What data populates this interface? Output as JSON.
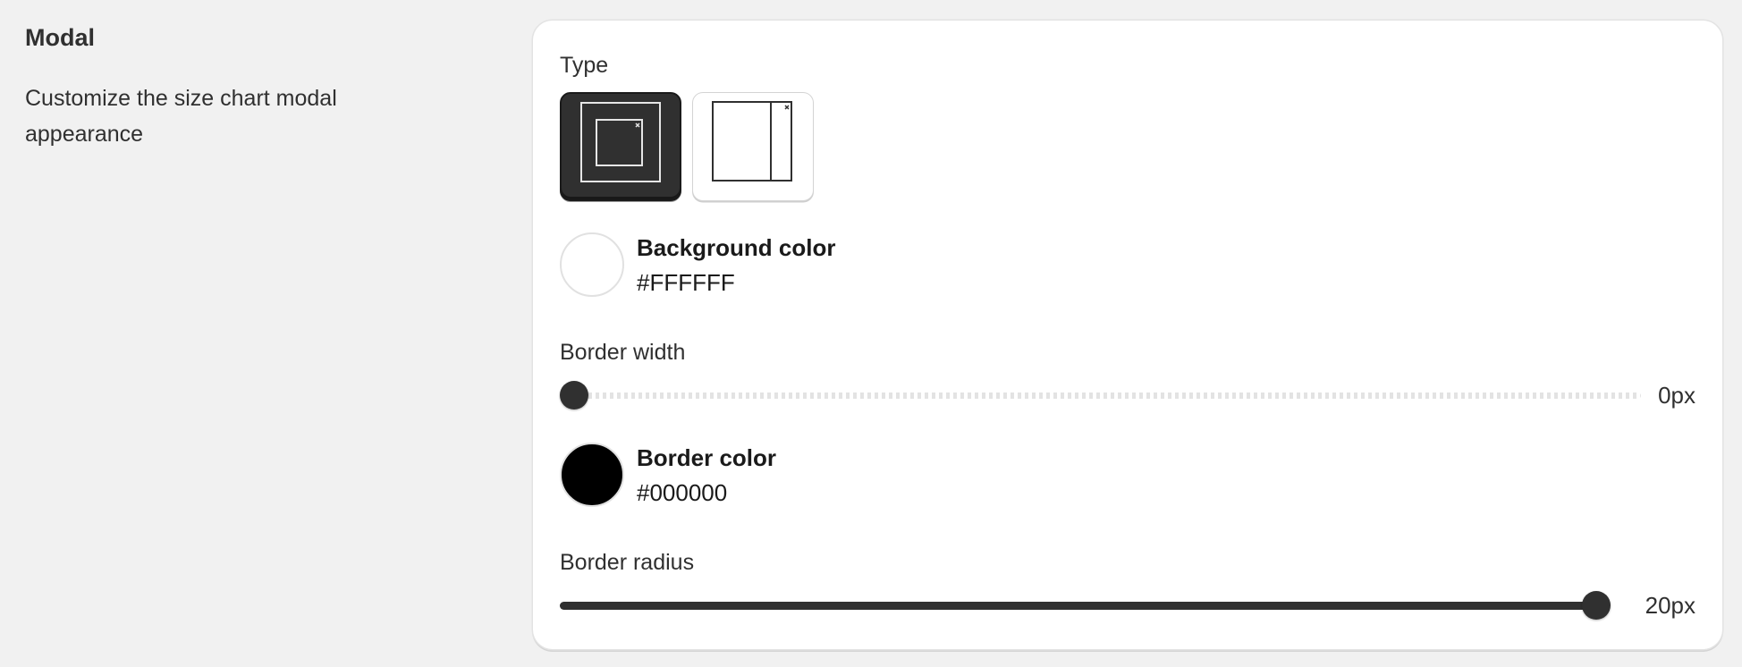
{
  "section": {
    "title": "Modal",
    "description": "Customize the size chart modal appearance"
  },
  "type_field": {
    "label": "Type",
    "options": [
      {
        "name": "centered-modal",
        "icon": "modal-centered-icon",
        "selected": true
      },
      {
        "name": "side-drawer",
        "icon": "drawer-right-icon",
        "selected": false
      }
    ]
  },
  "background_color": {
    "label": "Background color",
    "value": "#FFFFFF",
    "swatch": "#ffffff"
  },
  "border_width": {
    "label": "Border width",
    "value_text": "0px",
    "value": 0,
    "fraction": 0
  },
  "border_color": {
    "label": "Border color",
    "value": "#000000",
    "swatch": "#000000"
  },
  "border_radius": {
    "label": "Border radius",
    "value_text": "20px",
    "value": 20,
    "fraction": 1
  }
}
